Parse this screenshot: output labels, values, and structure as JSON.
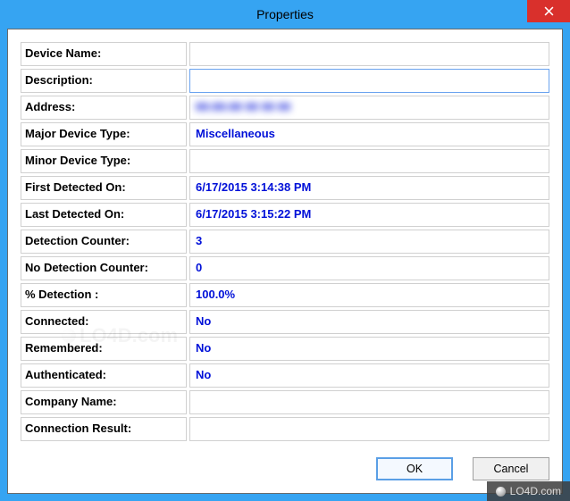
{
  "window": {
    "title": "Properties",
    "close_icon": "close-icon"
  },
  "fields": [
    {
      "label": "Device Name:",
      "value": "",
      "editable": false
    },
    {
      "label": "Description:",
      "value": "",
      "editable": true
    },
    {
      "label": "Address:",
      "value": "00:00:00 00 00 00",
      "editable": false,
      "blurred": true
    },
    {
      "label": "Major Device Type:",
      "value": "Miscellaneous",
      "editable": false
    },
    {
      "label": "Minor Device Type:",
      "value": "",
      "editable": false
    },
    {
      "label": "First Detected On:",
      "value": "6/17/2015 3:14:38 PM",
      "editable": false
    },
    {
      "label": "Last Detected On:",
      "value": "6/17/2015 3:15:22 PM",
      "editable": false
    },
    {
      "label": "Detection Counter:",
      "value": "3",
      "editable": false
    },
    {
      "label": "No Detection Counter:",
      "value": "0",
      "editable": false
    },
    {
      "label": "% Detection :",
      "value": "100.0%",
      "editable": false
    },
    {
      "label": "Connected:",
      "value": "No",
      "editable": false
    },
    {
      "label": "Remembered:",
      "value": "No",
      "editable": false
    },
    {
      "label": "Authenticated:",
      "value": "No",
      "editable": false
    },
    {
      "label": "Company Name:",
      "value": "",
      "editable": false
    },
    {
      "label": "Connection Result:",
      "value": "",
      "editable": false
    }
  ],
  "buttons": {
    "ok": "OK",
    "cancel": "Cancel"
  },
  "watermark": "LO4D.com"
}
